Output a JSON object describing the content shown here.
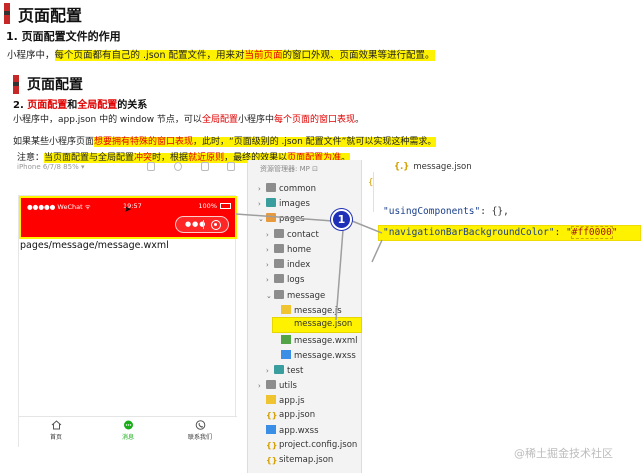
{
  "section1": {
    "heading": "页面配置",
    "subheading": "1. 页面配置文件的作用",
    "para": {
      "a": "小程序中，",
      "b": "每个页面都有自己的 .json 配置文件，用来对",
      "c": "当前页面",
      "d": "的窗口外观、页面效果等进行配置。"
    }
  },
  "section2": {
    "heading": "页面配置",
    "subheading": {
      "prefix": "2. ",
      "term1": "页面配置",
      "mid": "和",
      "term2": "全局配置",
      "suffix": "的关系"
    },
    "para1": {
      "a": "小程序中，app.json 中的 window 节点，可以",
      "b": "全局配置",
      "c": "小程序中",
      "d": "每个页面的窗口表现",
      "e": "。"
    },
    "para2": {
      "a": "如果某些小程序页面",
      "b": "想要拥有特殊的窗口表现",
      "c": "，此时，“页面级别的 .json 配置文件”就可以实现这种需求。"
    },
    "note": {
      "a": "注意：",
      "b": "当页面配置与全局配置",
      "c": "冲突",
      "d": "时，根据",
      "e": "就近原则",
      "f": "，最终的效果以",
      "g": "页面配置为准",
      "h": "。"
    }
  },
  "simulator": {
    "device": "iPhone 6/7/8 85% ▾",
    "status_left": "●●●●● WeChat ᯤ",
    "status_time": "19:57",
    "status_battery": "100%",
    "page_path": "pages/message/message.wxml",
    "tabs": [
      {
        "label": "首页",
        "icon": "home-icon"
      },
      {
        "label": "消息",
        "icon": "chat-icon"
      },
      {
        "label": "联系我们",
        "icon": "phone-icon"
      }
    ]
  },
  "tree": {
    "title": "资源管理器: MP ⊡",
    "items": [
      {
        "label": "common",
        "kind": "folder"
      },
      {
        "label": "images",
        "kind": "folder"
      },
      {
        "label": "pages",
        "kind": "folder-open"
      },
      {
        "label": "contact",
        "kind": "folder"
      },
      {
        "label": "home",
        "kind": "folder"
      },
      {
        "label": "index",
        "kind": "folder"
      },
      {
        "label": "logs",
        "kind": "folder"
      },
      {
        "label": "message",
        "kind": "folder-open"
      },
      {
        "label": "message.js",
        "kind": "js"
      },
      {
        "label": "message.json",
        "kind": "json"
      },
      {
        "label": "message.wxml",
        "kind": "wxml"
      },
      {
        "label": "message.wxss",
        "kind": "wxss"
      },
      {
        "label": "test",
        "kind": "folder"
      },
      {
        "label": "utils",
        "kind": "folder"
      },
      {
        "label": "app.js",
        "kind": "js"
      },
      {
        "label": "app.json",
        "kind": "json"
      },
      {
        "label": "app.wxss",
        "kind": "wxss"
      },
      {
        "label": "project.config.json",
        "kind": "json"
      },
      {
        "label": "sitemap.json",
        "kind": "json"
      }
    ]
  },
  "editor": {
    "tab_label": "message.json",
    "line1_key": "\"usingComponents\"",
    "line1_rest": ": {},",
    "line2_key": "\"navigationBarBackgroundColor\"",
    "line2_colon": ": \"",
    "line2_value": "#ff0000",
    "line2_end": "\""
  },
  "annotation": {
    "badge": "1",
    "highlight_color": "#fff200",
    "nav_color": "#ff0000",
    "badge_color": "#1e2fb8"
  },
  "watermark": "@稀土掘金技术社区"
}
